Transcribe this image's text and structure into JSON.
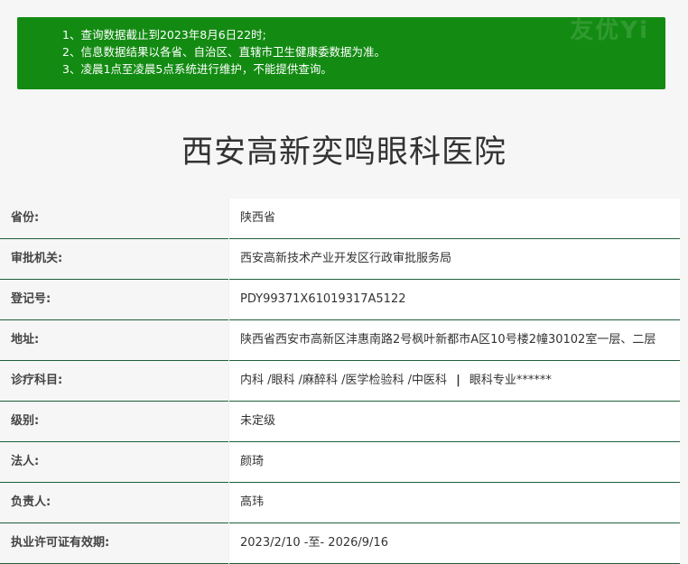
{
  "notice": {
    "lines": [
      "1、查询数据截止到2023年8月6日22时;",
      "2、信息数据结果以各省、自治区、直辖市卫生健康委数据为准。",
      "3、凌晨1点至凌晨5点系统进行维护，不能提供查询。"
    ],
    "watermark": "友优Yi"
  },
  "hospital": {
    "name": "西安高新奕鸣眼科医院"
  },
  "rows": [
    {
      "label": "省份:",
      "value": "陕西省"
    },
    {
      "label": "审批机关:",
      "value": "西安高新技术产业开发区行政审批服务局"
    },
    {
      "label": "登记号:",
      "value": "PDY99371X61019317A5122"
    },
    {
      "label": "地址:",
      "value": "陕西省西安市高新区沣惠南路2号枫叶新都市A区10号楼2幢30102室一层、二层"
    },
    {
      "label": "诊疗科目:",
      "value": "内科 /眼科 /麻醉科 /医学检验科 /中医科",
      "separator": "|",
      "value2": "眼科专业******"
    },
    {
      "label": "级别:",
      "value": "未定级"
    },
    {
      "label": "法人:",
      "value": "颜琦"
    },
    {
      "label": "负责人:",
      "value": "高玮"
    },
    {
      "label": "执业许可证有效期:",
      "value": "2023/2/10 -至- 2026/9/16"
    }
  ],
  "colors": {
    "notice_bg": "#138b13",
    "row_border": "#1f5f3a"
  }
}
